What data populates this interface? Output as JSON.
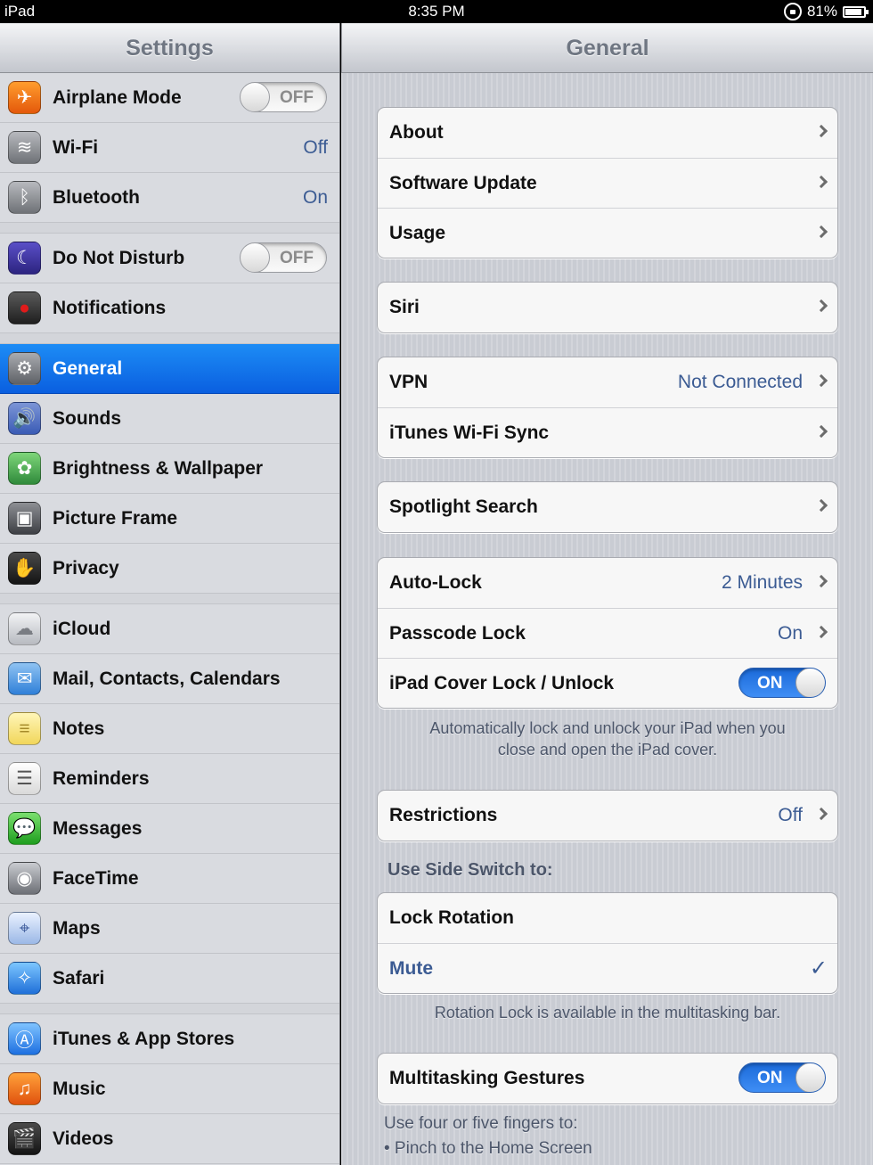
{
  "status_bar": {
    "device": "iPad",
    "time": "8:35 PM",
    "battery": "81%"
  },
  "master": {
    "title": "Settings",
    "groups": [
      [
        {
          "label": "Airplane Mode",
          "icon": "airplane-icon",
          "toggle": "OFF"
        },
        {
          "label": "Wi-Fi",
          "icon": "wifi-icon",
          "value": "Off"
        },
        {
          "label": "Bluetooth",
          "icon": "bluetooth-icon",
          "value": "On"
        }
      ],
      [
        {
          "label": "Do Not Disturb",
          "icon": "moon-icon",
          "toggle": "OFF"
        },
        {
          "label": "Notifications",
          "icon": "notifications-icon"
        }
      ],
      [
        {
          "label": "General",
          "icon": "gear-icon",
          "selected": true
        },
        {
          "label": "Sounds",
          "icon": "speaker-icon"
        },
        {
          "label": "Brightness & Wallpaper",
          "icon": "flower-icon"
        },
        {
          "label": "Picture Frame",
          "icon": "picture-frame-icon"
        },
        {
          "label": "Privacy",
          "icon": "hand-icon"
        }
      ],
      [
        {
          "label": "iCloud",
          "icon": "cloud-icon"
        },
        {
          "label": "Mail, Contacts, Calendars",
          "icon": "envelope-icon"
        },
        {
          "label": "Notes",
          "icon": "notepad-icon"
        },
        {
          "label": "Reminders",
          "icon": "checklist-icon"
        },
        {
          "label": "Messages",
          "icon": "speech-bubble-icon"
        },
        {
          "label": "FaceTime",
          "icon": "video-camera-icon"
        },
        {
          "label": "Maps",
          "icon": "map-icon"
        },
        {
          "label": "Safari",
          "icon": "compass-icon"
        }
      ],
      [
        {
          "label": "iTunes & App Stores",
          "icon": "app-store-icon"
        },
        {
          "label": "Music",
          "icon": "music-note-icon"
        },
        {
          "label": "Videos",
          "icon": "clapperboard-icon"
        }
      ]
    ]
  },
  "detail": {
    "title": "General",
    "about": {
      "label": "About"
    },
    "software_update": {
      "label": "Software Update"
    },
    "usage": {
      "label": "Usage"
    },
    "siri": {
      "label": "Siri"
    },
    "vpn": {
      "label": "VPN",
      "value": "Not Connected"
    },
    "itunes_sync": {
      "label": "iTunes Wi-Fi Sync"
    },
    "spotlight": {
      "label": "Spotlight Search"
    },
    "auto_lock": {
      "label": "Auto-Lock",
      "value": "2 Minutes"
    },
    "passcode_lock": {
      "label": "Passcode Lock",
      "value": "On"
    },
    "cover_lock": {
      "label": "iPad Cover Lock / Unlock",
      "toggle": "ON"
    },
    "cover_lock_footer": {
      "line1": "Automatically lock and unlock your iPad when you",
      "line2": "close and open the iPad cover."
    },
    "restrictions": {
      "label": "Restrictions",
      "value": "Off"
    },
    "side_switch_header": "Use Side Switch to:",
    "lock_rotation": {
      "label": "Lock Rotation"
    },
    "mute": {
      "label": "Mute",
      "check": "✓"
    },
    "side_switch_footer": "Rotation Lock is available in the multitasking bar.",
    "multitasking": {
      "label": "Multitasking Gestures",
      "toggle": "ON"
    },
    "gestures_intro": "Use four or five fingers to:",
    "gestures_item1": "• Pinch to the Home Screen"
  }
}
